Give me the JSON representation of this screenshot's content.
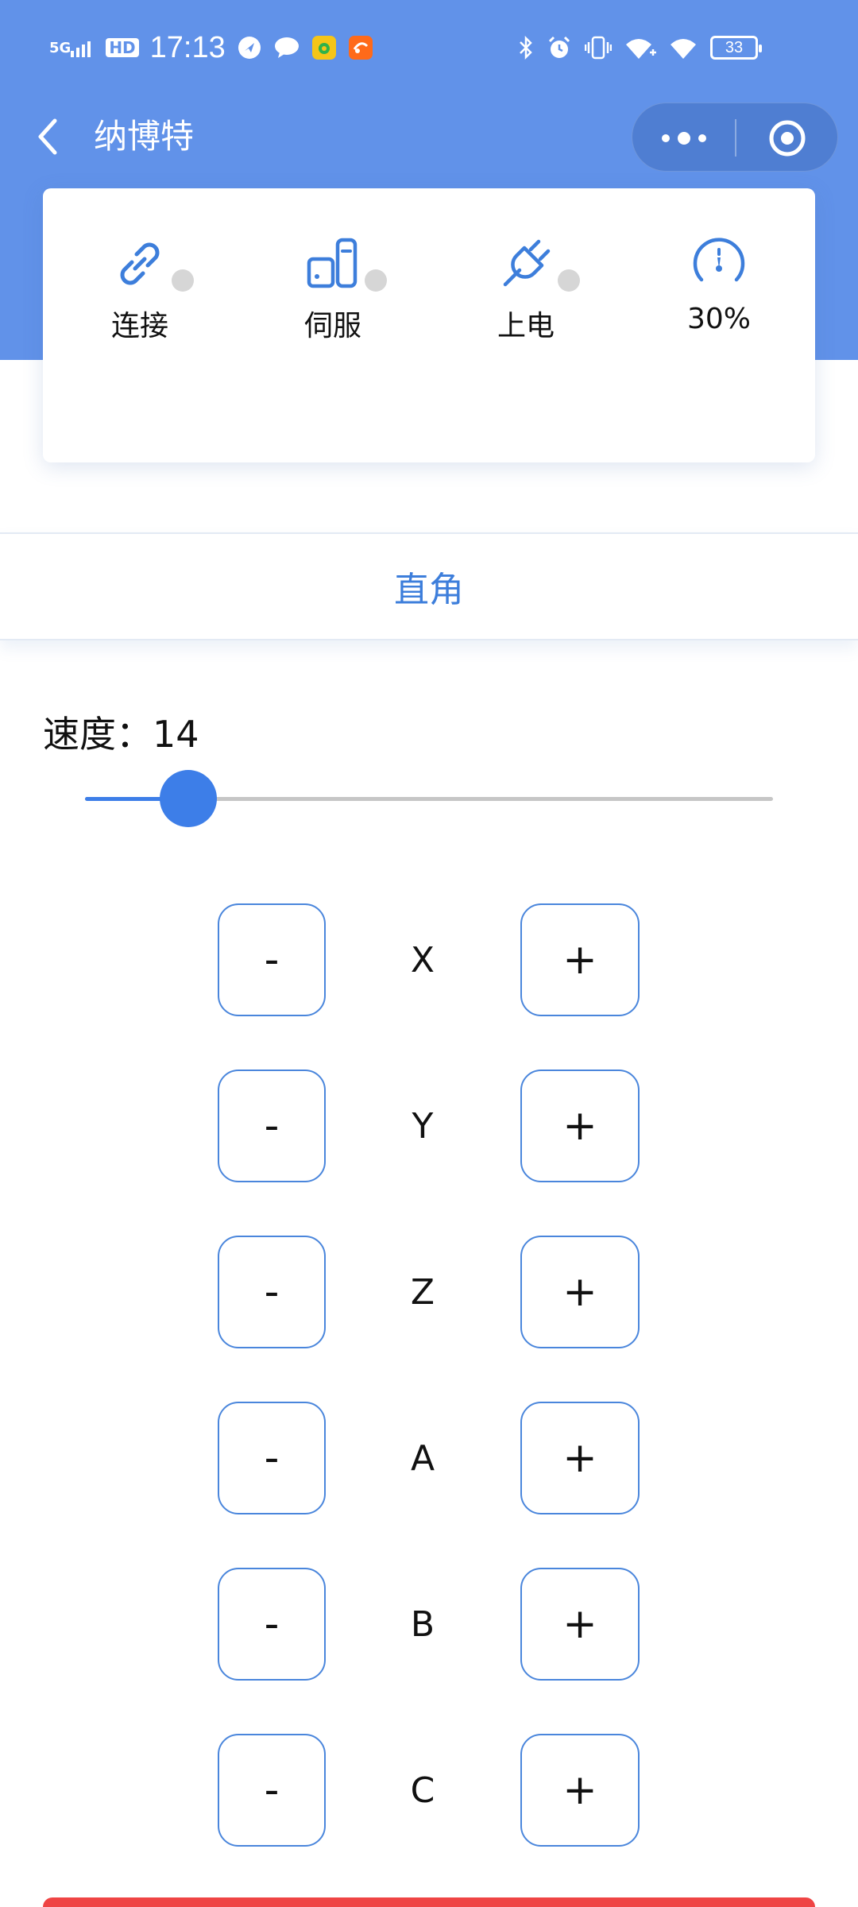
{
  "status_bar": {
    "network": "5G",
    "hd": "HD",
    "time": "17:13",
    "battery": "33"
  },
  "nav": {
    "title": "纳博特"
  },
  "status": {
    "connect_label": "连接",
    "servo_label": "伺服",
    "power_label": "上电",
    "speed_ratio_label": "30%"
  },
  "mode": {
    "label": "直角"
  },
  "speed": {
    "label": "速度：",
    "value": "14",
    "slider_fraction": 0.15
  },
  "axes": [
    {
      "name": "X",
      "minus": "-",
      "plus": "+"
    },
    {
      "name": "Y",
      "minus": "-",
      "plus": "+"
    },
    {
      "name": "Z",
      "minus": "-",
      "plus": "+"
    },
    {
      "name": "A",
      "minus": "-",
      "plus": "+"
    },
    {
      "name": "B",
      "minus": "-",
      "plus": "+"
    },
    {
      "name": "C",
      "minus": "-",
      "plus": "+"
    }
  ],
  "colors": {
    "header": "#6192e9",
    "accent": "#3d7edb",
    "indicator_off": "#d6d6d6",
    "danger": "#ef4444"
  }
}
